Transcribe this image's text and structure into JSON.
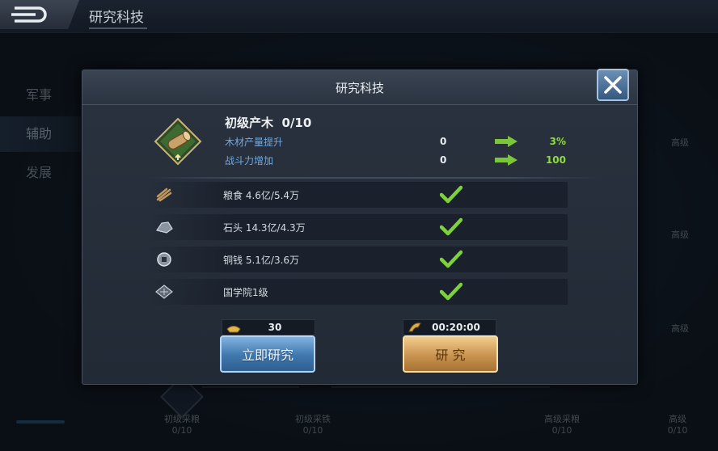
{
  "header": {
    "title": "研究科技"
  },
  "sidebar": {
    "items": [
      {
        "label": "军事"
      },
      {
        "label": "辅助",
        "active": true
      },
      {
        "label": "发展"
      }
    ]
  },
  "background_tree": {
    "nodes": [
      {
        "name": "初级采粮",
        "progress": "0/10"
      },
      {
        "name": "初级采铁",
        "progress": "0/10"
      },
      {
        "name": "高级采粮",
        "progress": "0/10"
      },
      {
        "name": "高级",
        "progress": "0/10"
      }
    ],
    "side_labels": [
      "高级",
      "高级",
      "高级"
    ]
  },
  "dialog": {
    "title": "研究科技",
    "item": {
      "name": "初级产木",
      "level": "0/10",
      "icon": "wood-log-icon"
    },
    "stats": [
      {
        "label": "木材产量提升",
        "current": "0",
        "next": "3%"
      },
      {
        "label": "战斗力增加",
        "current": "0",
        "next": "100"
      }
    ],
    "requirements": [
      {
        "icon": "food-icon",
        "text": "粮食  4.6亿/5.4万",
        "met": true
      },
      {
        "icon": "stone-icon",
        "text": "石头  14.3亿/4.3万",
        "met": true
      },
      {
        "icon": "coin-icon",
        "text": "铜钱  5.1亿/3.6万",
        "met": true
      },
      {
        "icon": "academy-icon",
        "text": "国学院1级",
        "met": true
      }
    ],
    "instant": {
      "cost": "30",
      "label": "立即研究",
      "icon": "gold-ingot-icon"
    },
    "research": {
      "time": "00:20:00",
      "label": "研  究",
      "icon": "hourglass-icon"
    }
  },
  "colors": {
    "stat_label": "#6fa9e2",
    "stat_gain": "#8fdc3e",
    "check": "#7ed13a"
  }
}
